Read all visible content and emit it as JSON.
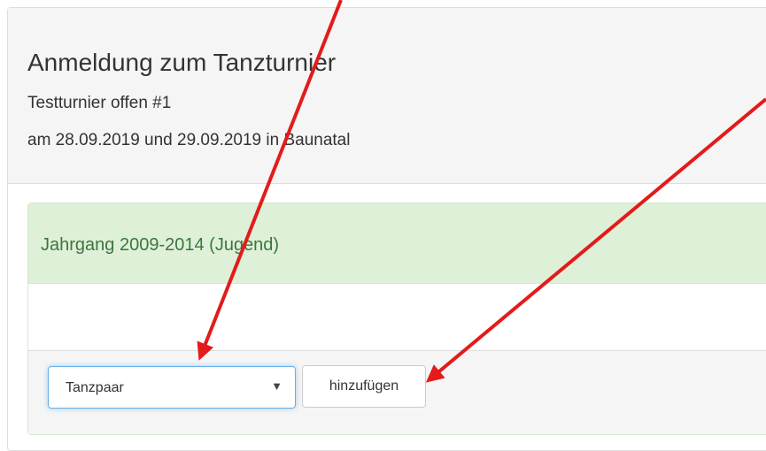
{
  "header": {
    "title": "Anmeldung zum Tanzturnier",
    "tournament": "Testturnier offen #1",
    "dates": "am 28.09.2019 und 29.09.2019 in Baunatal"
  },
  "group": {
    "title": "Jahrgang 2009-2014 (Jugend)",
    "select_value": "Tanzpaar",
    "select_caret": "▼",
    "add_label": "hinzufügen"
  },
  "colors": {
    "arrow": "#e31b1b",
    "group_heading_bg": "#dff0d8",
    "group_title": "#3c763d",
    "focus_border": "#66afe9"
  }
}
